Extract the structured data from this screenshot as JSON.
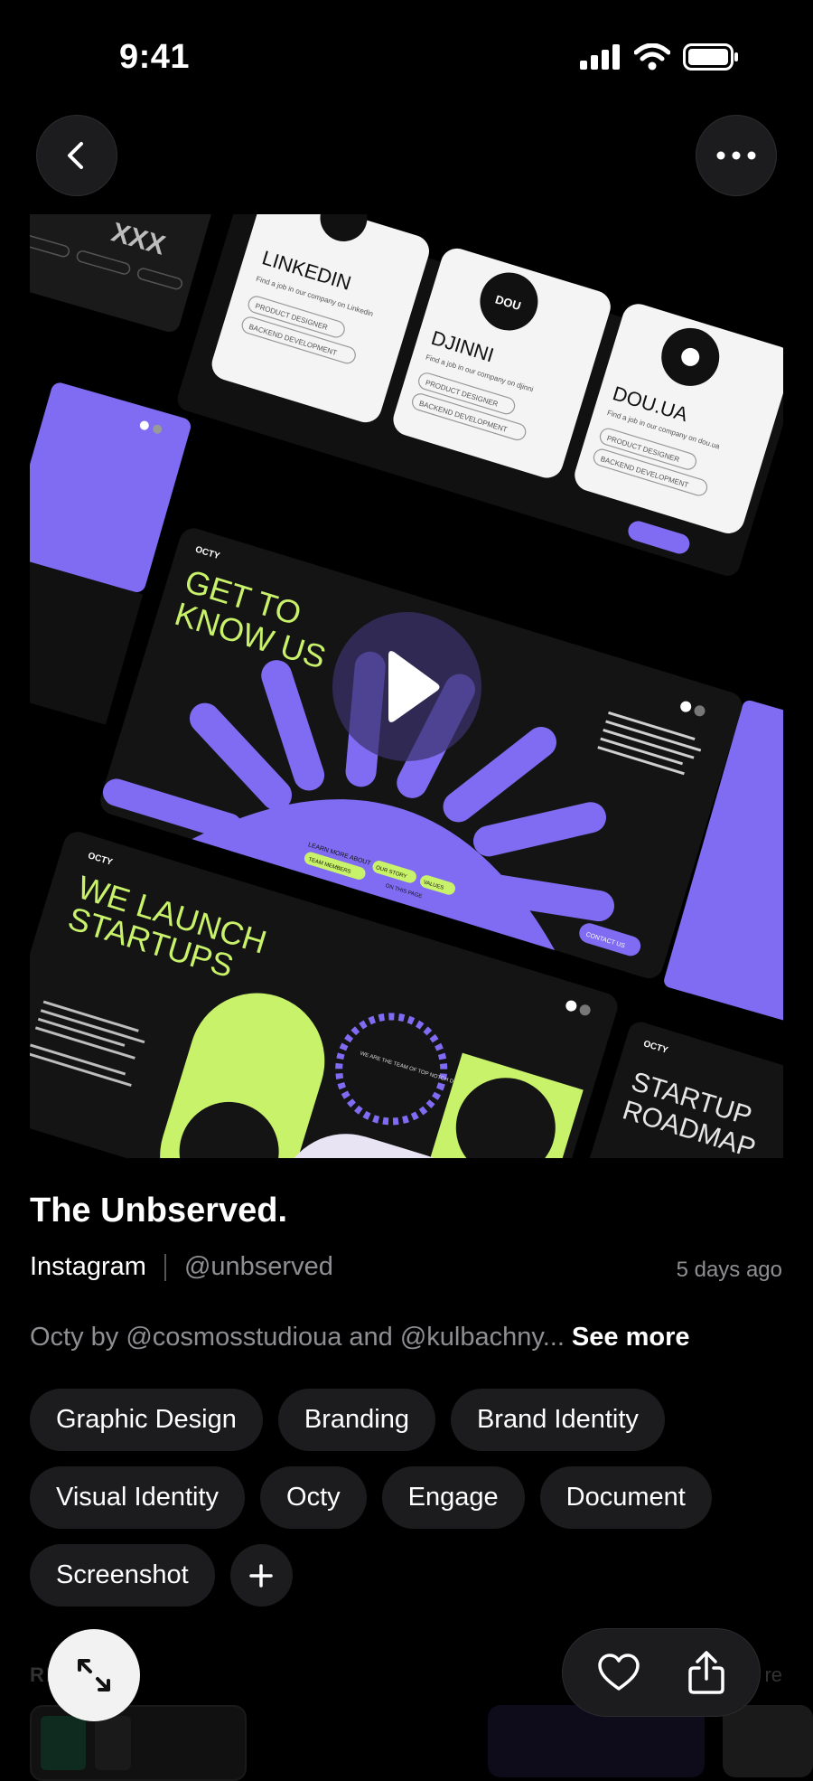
{
  "status_bar": {
    "time": "9:41",
    "icons": [
      "signal-icon",
      "wifi-icon",
      "battery-icon"
    ]
  },
  "top_bar": {
    "back_icon": "chevron-left-icon",
    "more_icon": "ellipsis-icon"
  },
  "media": {
    "cards": [
      {
        "title": "LINKEDIN",
        "subtitle": "Find a job in our company on Linkedin",
        "chips": [
          "PRODUCT DESIGNER",
          "BACKEND DEVELOPMENT"
        ]
      },
      {
        "title": "DJINNI",
        "badge": "DOU",
        "subtitle": "Find a job in our company on djinni",
        "chips": [
          "PRODUCT DESIGNER",
          "BACKEND DEVELOPMENT"
        ]
      },
      {
        "title": "DOU.UA",
        "subtitle": "Find a job in our company on dou.ua",
        "chips": [
          "PRODUCT DESIGNER",
          "BACKEND DEVELOPMENT"
        ]
      }
    ],
    "slide1": {
      "brand": "OCTY",
      "heading_line1": "GET TO",
      "heading_line2": "KNOW US",
      "learn_more": "LEARN MORE ABOUT",
      "chip_team": "TEAM MEMBERS",
      "chip_story": "OUR STORY",
      "chip_values": "VALUES",
      "on_page": "ON THIS PAGE",
      "contact": "CONTACT US"
    },
    "slide2": {
      "brand": "OCTY",
      "heading_line1": "WE LAUNCH",
      "heading_line2": "STARTUPS",
      "badge_text": "WE ARE THE TEAM OF TOP NOTCH DEVELOPERS"
    },
    "slide3": {
      "brand": "OCTY",
      "heading_line1": "STARTUP",
      "heading_line2": "ROADMAP"
    },
    "corner_text": "XXX",
    "play_icon": "play-icon",
    "colors": {
      "purple": "#7f6cf2",
      "lime": "#c9f26b",
      "dark": "#141414"
    }
  },
  "post": {
    "title": "The Unbserved.",
    "platform": "Instagram",
    "handle": "@unbserved",
    "time_ago": "5 days ago",
    "description": "Octy by @cosmosstudioua and @kulbachny...",
    "see_more": "See more"
  },
  "tags": [
    "Graphic Design",
    "Branding",
    "Brand Identity",
    "Visual Identity",
    "Octy",
    "Engage",
    "Document",
    "Screenshot"
  ],
  "add_tag_icon": "plus-icon",
  "related": {
    "label": "RE",
    "more": "re"
  },
  "actions": {
    "expand_icon": "expand-icon",
    "like_icon": "heart-icon",
    "share_icon": "share-icon"
  }
}
